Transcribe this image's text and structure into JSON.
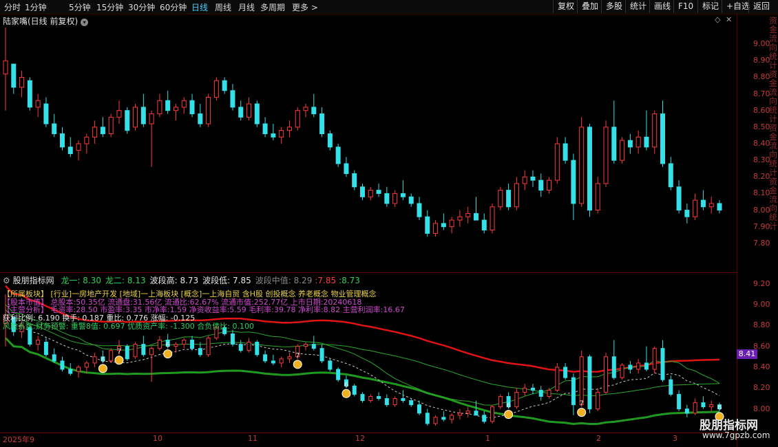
{
  "toolbar": {
    "periods": [
      "分时",
      "1分钟",
      "5分钟",
      "15分钟",
      "30分钟",
      "60分钟",
      "日线",
      "周线",
      "月线",
      "多周期",
      "更多 >"
    ],
    "active_period": "日线",
    "right_buttons": [
      "复权",
      "叠加",
      "多股",
      "统计",
      "画线",
      "F10",
      "标记",
      "+自选",
      "返回"
    ]
  },
  "upper_panel": {
    "title": "陆家嘴(日线 前复权)",
    "y_ticks": [
      "9.00",
      "8.90",
      "8.80",
      "8.70",
      "8.60",
      "8.50",
      "8.40",
      "8.30",
      "8.20",
      "8.10",
      "8.00",
      "7.90",
      "7.80"
    ],
    "vertical_text": "资金流向统计资金流向统计资金流向统计资金流向统计"
  },
  "lower_panel": {
    "indicator_name": "股朋指标网",
    "values": [
      {
        "label": "龙一:",
        "value": "8.30",
        "color": "#2ed15a"
      },
      {
        "label": "龙二:",
        "value": "8.13",
        "color": "#2ed15a"
      },
      {
        "label": "波段高:",
        "value": "8.73",
        "color": "#e8e8e8"
      },
      {
        "label": "波段低:",
        "value": "7.85",
        "color": "#e8e8e8"
      },
      {
        "label": "波段中值:",
        "value": "8.29",
        "color": "#888888"
      }
    ],
    "extra_values": [
      ":7.85",
      ":8.73"
    ],
    "row1": "【所属板块】  [行业]一房地产开发  [地域]一上海板块  [概念]一上海自贸 含H股 创投概念 养老概念 物业管理概念",
    "row2": "【股本市值】  总股本:50.35亿  流通盘:31.56亿  流通比:62.67%  流通市值:252.77亿  上市日期:20240618",
    "row3": "【主营分析】  毛资率:28.50  市盈率:3.35  市净率:1.59  净资收益率:5.59  毛利率:39.78  净利率:8.82  主营利润率:16.67",
    "row4": "获利比例: 6.190   换手: 0.187   重比: 0.776   涨幅: -0.125",
    "row5": "风险系数:财务预警: 重警8值: 0.697 优质资产率: -1.300 合负债比: 0.100",
    "y_ticks": [
      "9.20",
      "9.00",
      "8.80",
      "8.60",
      "8.40",
      "8.20",
      "8.00"
    ],
    "price_tag": "8.41",
    "markers": [
      "6",
      "7",
      "6",
      "7",
      "6",
      "6",
      "7",
      "6"
    ]
  },
  "x_axis": [
    "2025年9",
    "10",
    "11",
    "12",
    "1",
    "2",
    "3"
  ],
  "watermark": {
    "main": "股朋指标网",
    "sub": "www.7gpzb.com"
  },
  "colors": {
    "up": "#ff3b3b",
    "down": "#35e0e8",
    "ma_green": "#2ca82c",
    "band_red": "#e01414",
    "band_green": "#1f9a1f",
    "magenta": "#d048d0"
  },
  "chart_data": {
    "type": "candlestick",
    "candles": [
      {
        "o": 8.82,
        "h": 9.1,
        "l": 8.6,
        "c": 8.9
      },
      {
        "o": 8.88,
        "h": 8.88,
        "l": 8.7,
        "c": 8.74
      },
      {
        "o": 8.74,
        "h": 8.84,
        "l": 8.68,
        "c": 8.8
      },
      {
        "o": 8.78,
        "h": 8.8,
        "l": 8.6,
        "c": 8.62
      },
      {
        "o": 8.62,
        "h": 8.7,
        "l": 8.56,
        "c": 8.66
      },
      {
        "o": 8.64,
        "h": 8.68,
        "l": 8.5,
        "c": 8.52
      },
      {
        "o": 8.52,
        "h": 8.58,
        "l": 8.44,
        "c": 8.46
      },
      {
        "o": 8.46,
        "h": 8.5,
        "l": 8.36,
        "c": 8.38
      },
      {
        "o": 8.38,
        "h": 8.44,
        "l": 8.32,
        "c": 8.34
      },
      {
        "o": 8.36,
        "h": 8.42,
        "l": 8.3,
        "c": 8.4
      },
      {
        "o": 8.4,
        "h": 8.46,
        "l": 8.34,
        "c": 8.44
      },
      {
        "o": 8.44,
        "h": 8.54,
        "l": 8.4,
        "c": 8.5
      },
      {
        "o": 8.5,
        "h": 8.56,
        "l": 8.44,
        "c": 8.46
      },
      {
        "o": 8.46,
        "h": 8.58,
        "l": 8.44,
        "c": 8.56
      },
      {
        "o": 8.56,
        "h": 8.66,
        "l": 8.52,
        "c": 8.6
      },
      {
        "o": 8.6,
        "h": 8.62,
        "l": 8.46,
        "c": 8.48
      },
      {
        "o": 8.5,
        "h": 8.64,
        "l": 8.48,
        "c": 8.62
      },
      {
        "o": 8.62,
        "h": 8.7,
        "l": 8.5,
        "c": 8.52
      },
      {
        "o": 8.52,
        "h": 8.6,
        "l": 8.26,
        "c": 8.58
      },
      {
        "o": 8.58,
        "h": 8.7,
        "l": 8.56,
        "c": 8.66
      },
      {
        "o": 8.66,
        "h": 8.72,
        "l": 8.58,
        "c": 8.6
      },
      {
        "o": 8.6,
        "h": 8.64,
        "l": 8.54,
        "c": 8.62
      },
      {
        "o": 8.62,
        "h": 8.68,
        "l": 8.58,
        "c": 8.66
      },
      {
        "o": 8.66,
        "h": 8.7,
        "l": 8.56,
        "c": 8.58
      },
      {
        "o": 8.58,
        "h": 8.64,
        "l": 8.5,
        "c": 8.52
      },
      {
        "o": 8.52,
        "h": 8.7,
        "l": 8.5,
        "c": 8.68
      },
      {
        "o": 8.68,
        "h": 8.8,
        "l": 8.66,
        "c": 8.78
      },
      {
        "o": 8.78,
        "h": 8.8,
        "l": 8.7,
        "c": 8.72
      },
      {
        "o": 8.72,
        "h": 8.76,
        "l": 8.6,
        "c": 8.62
      },
      {
        "o": 8.62,
        "h": 8.66,
        "l": 8.54,
        "c": 8.56
      },
      {
        "o": 8.56,
        "h": 8.68,
        "l": 8.54,
        "c": 8.64
      },
      {
        "o": 8.64,
        "h": 8.66,
        "l": 8.5,
        "c": 8.52
      },
      {
        "o": 8.52,
        "h": 8.56,
        "l": 8.44,
        "c": 8.46
      },
      {
        "o": 8.46,
        "h": 8.52,
        "l": 8.42,
        "c": 8.44
      },
      {
        "o": 8.44,
        "h": 8.5,
        "l": 8.4,
        "c": 8.48
      },
      {
        "o": 8.48,
        "h": 8.54,
        "l": 8.44,
        "c": 8.5
      },
      {
        "o": 8.5,
        "h": 8.62,
        "l": 8.48,
        "c": 8.6
      },
      {
        "o": 8.6,
        "h": 8.64,
        "l": 8.56,
        "c": 8.62
      },
      {
        "o": 8.62,
        "h": 8.7,
        "l": 8.56,
        "c": 8.58
      },
      {
        "o": 8.58,
        "h": 8.62,
        "l": 8.44,
        "c": 8.46
      },
      {
        "o": 8.46,
        "h": 8.48,
        "l": 8.36,
        "c": 8.38
      },
      {
        "o": 8.38,
        "h": 8.4,
        "l": 8.26,
        "c": 8.28
      },
      {
        "o": 8.28,
        "h": 8.32,
        "l": 8.2,
        "c": 8.22
      },
      {
        "o": 8.22,
        "h": 8.24,
        "l": 8.12,
        "c": 8.14
      },
      {
        "o": 8.14,
        "h": 8.16,
        "l": 8.06,
        "c": 8.08
      },
      {
        "o": 8.08,
        "h": 8.14,
        "l": 8.06,
        "c": 8.12
      },
      {
        "o": 8.12,
        "h": 8.16,
        "l": 8.08,
        "c": 8.1
      },
      {
        "o": 8.1,
        "h": 8.14,
        "l": 8.02,
        "c": 8.04
      },
      {
        "o": 8.04,
        "h": 8.12,
        "l": 8.02,
        "c": 8.1
      },
      {
        "o": 8.1,
        "h": 8.18,
        "l": 8.06,
        "c": 8.08
      },
      {
        "o": 8.08,
        "h": 8.1,
        "l": 8.02,
        "c": 8.04
      },
      {
        "o": 8.04,
        "h": 8.08,
        "l": 7.94,
        "c": 7.96
      },
      {
        "o": 7.96,
        "h": 8.0,
        "l": 7.84,
        "c": 7.86
      },
      {
        "o": 7.86,
        "h": 7.94,
        "l": 7.84,
        "c": 7.92
      },
      {
        "o": 7.92,
        "h": 7.98,
        "l": 7.88,
        "c": 7.9
      },
      {
        "o": 7.9,
        "h": 7.96,
        "l": 7.86,
        "c": 7.94
      },
      {
        "o": 7.94,
        "h": 8.0,
        "l": 7.9,
        "c": 7.96
      },
      {
        "o": 7.96,
        "h": 8.02,
        "l": 7.92,
        "c": 7.98
      },
      {
        "o": 7.98,
        "h": 8.08,
        "l": 7.94,
        "c": 7.94
      },
      {
        "o": 7.94,
        "h": 7.98,
        "l": 7.86,
        "c": 7.88
      },
      {
        "o": 7.88,
        "h": 8.04,
        "l": 7.86,
        "c": 8.02
      },
      {
        "o": 8.02,
        "h": 8.14,
        "l": 8.0,
        "c": 8.12
      },
      {
        "o": 8.12,
        "h": 8.16,
        "l": 8.0,
        "c": 8.02
      },
      {
        "o": 8.02,
        "h": 8.2,
        "l": 8.0,
        "c": 8.16
      },
      {
        "o": 8.16,
        "h": 8.24,
        "l": 8.12,
        "c": 8.2
      },
      {
        "o": 8.2,
        "h": 8.24,
        "l": 8.14,
        "c": 8.18
      },
      {
        "o": 8.18,
        "h": 8.22,
        "l": 8.08,
        "c": 8.12
      },
      {
        "o": 8.12,
        "h": 8.2,
        "l": 8.1,
        "c": 8.18
      },
      {
        "o": 8.18,
        "h": 8.44,
        "l": 8.16,
        "c": 8.4
      },
      {
        "o": 8.4,
        "h": 8.44,
        "l": 8.28,
        "c": 8.3
      },
      {
        "o": 8.3,
        "h": 8.34,
        "l": 7.94,
        "c": 8.04
      },
      {
        "o": 8.04,
        "h": 8.56,
        "l": 8.02,
        "c": 8.5
      },
      {
        "o": 8.5,
        "h": 8.52,
        "l": 7.96,
        "c": 8.0
      },
      {
        "o": 8.0,
        "h": 8.2,
        "l": 7.98,
        "c": 8.16
      },
      {
        "o": 8.16,
        "h": 8.54,
        "l": 8.14,
        "c": 8.5
      },
      {
        "o": 8.5,
        "h": 8.66,
        "l": 8.28,
        "c": 8.3
      },
      {
        "o": 8.3,
        "h": 8.44,
        "l": 8.28,
        "c": 8.42
      },
      {
        "o": 8.42,
        "h": 8.46,
        "l": 8.34,
        "c": 8.38
      },
      {
        "o": 8.38,
        "h": 8.48,
        "l": 8.34,
        "c": 8.44
      },
      {
        "o": 8.44,
        "h": 8.6,
        "l": 8.36,
        "c": 8.38
      },
      {
        "o": 8.38,
        "h": 8.6,
        "l": 8.34,
        "c": 8.58
      },
      {
        "o": 8.58,
        "h": 8.66,
        "l": 8.26,
        "c": 8.28
      },
      {
        "o": 8.28,
        "h": 8.32,
        "l": 8.12,
        "c": 8.14
      },
      {
        "o": 8.14,
        "h": 8.18,
        "l": 7.98,
        "c": 8.0
      },
      {
        "o": 8.0,
        "h": 8.04,
        "l": 7.92,
        "c": 7.96
      },
      {
        "o": 7.96,
        "h": 8.1,
        "l": 7.94,
        "c": 8.06
      },
      {
        "o": 8.06,
        "h": 8.12,
        "l": 8.0,
        "c": 8.02
      },
      {
        "o": 8.02,
        "h": 8.08,
        "l": 7.98,
        "c": 8.04
      },
      {
        "o": 8.04,
        "h": 8.06,
        "l": 7.98,
        "c": 8.0
      }
    ],
    "lower_candles_shift": 8.0,
    "ylim_upper": [
      7.7,
      9.1
    ],
    "ylim_lower": [
      7.8,
      9.25
    ]
  }
}
